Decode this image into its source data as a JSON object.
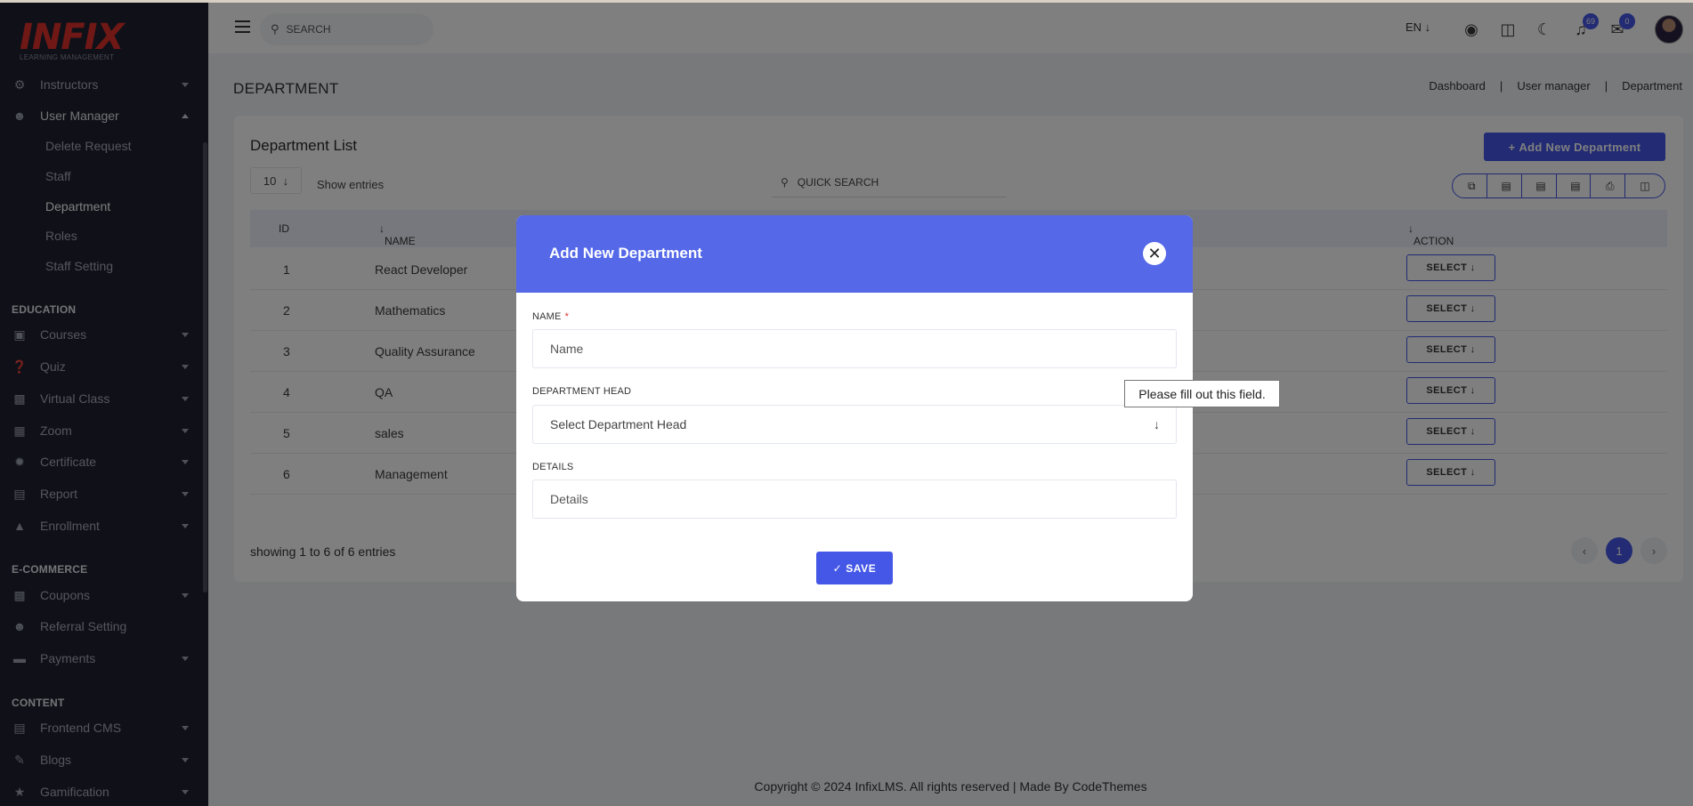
{
  "logo": {
    "main": "INFIX",
    "sub": "LEARNING MANAGEMENT"
  },
  "sidebar": {
    "items": [
      {
        "label": "Instructors",
        "icon": "instructor-icon"
      },
      {
        "label": "User Manager",
        "icon": "user-gear-icon"
      }
    ],
    "sub_items": [
      "Delete Request",
      "Staff",
      "Department",
      "Roles",
      "Staff Setting"
    ],
    "sections": {
      "education": "EDUCATION",
      "ecommerce": "E-COMMERCE",
      "content": "CONTENT"
    },
    "education_items": [
      "Courses",
      "Quiz",
      "Virtual Class",
      "Zoom",
      "Certificate",
      "Report",
      "Enrollment"
    ],
    "ecommerce_items": [
      "Coupons",
      "Referral Setting",
      "Payments"
    ],
    "content_items": [
      "Frontend CMS",
      "Blogs",
      "Gamification"
    ]
  },
  "header": {
    "search_placeholder": "SEARCH",
    "lang": "EN",
    "notification_count": "69",
    "message_count": "0"
  },
  "page": {
    "title": "DEPARTMENT",
    "breadcrumb": [
      "Dashboard",
      "User manager",
      "Department"
    ]
  },
  "card": {
    "title": "Department List",
    "add_button": "Add New Department",
    "entries_value": "10",
    "show_entries": "Show entries",
    "quick_search_placeholder": "QUICK SEARCH",
    "columns": {
      "id": "ID",
      "name": "NAME",
      "action": "ACTION"
    },
    "rows": [
      {
        "id": "1",
        "name": "React Developer",
        "action": "SELECT"
      },
      {
        "id": "2",
        "name": "Mathematics",
        "action": "SELECT"
      },
      {
        "id": "3",
        "name": "Quality Assurance",
        "action": "SELECT"
      },
      {
        "id": "4",
        "name": "QA",
        "action": "SELECT"
      },
      {
        "id": "5",
        "name": "sales",
        "action": "SELECT"
      },
      {
        "id": "6",
        "name": "Management",
        "action": "SELECT"
      }
    ],
    "showing": "showing 1 to 6 of 6 entries",
    "current_page": "1"
  },
  "footer": {
    "text": "Copyright © 2024 InfixLMS. All rights reserved | Made By CodeThemes"
  },
  "modal": {
    "title": "Add New Department",
    "name_label": "NAME",
    "name_required": "*",
    "name_placeholder": "Name",
    "head_label": "DEPARTMENT HEAD",
    "head_selected": "Select Department Head",
    "details_label": "DETAILS",
    "details_placeholder": "Details",
    "save": "SAVE"
  },
  "tooltip": {
    "text": "Please fill out this field."
  },
  "colors": {
    "accent": "#4457e6",
    "modal_header": "#5468e8",
    "sidebar": "#202231",
    "brand": "#e0302a"
  }
}
